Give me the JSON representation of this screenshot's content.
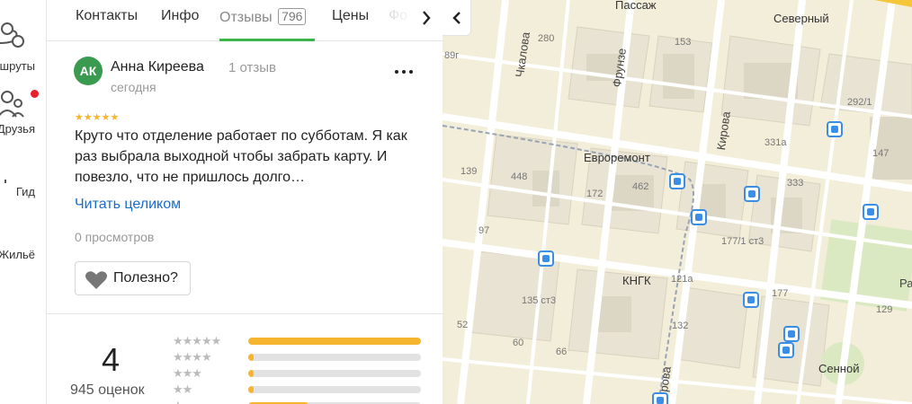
{
  "rail": {
    "items": [
      {
        "label": "Маршруты"
      },
      {
        "label": "Друзья"
      },
      {
        "label": "Гид"
      },
      {
        "label": "Жильё"
      }
    ]
  },
  "tabs": {
    "items": [
      {
        "label": "Контакты"
      },
      {
        "label": "Инфо"
      },
      {
        "label": "Отзывы",
        "count": "796"
      },
      {
        "label": "Цены"
      },
      {
        "label": "Фо"
      }
    ]
  },
  "review": {
    "avatar_initials": "АК",
    "author": "Анна Киреева",
    "review_count": "1 отзыв",
    "date": "сегодня",
    "stars": "★★★★★",
    "rating": 5,
    "text": "Круто что отделение работает по субботам. Я как раз выбрала выходной чтобы забрать карту. И повезло, что не пришлось долго…",
    "read_more": "Читать целиком",
    "views": "0 просмотров",
    "useful_label": "Полезно?"
  },
  "summary": {
    "rating": "4",
    "count": "945 оценок",
    "distribution": [
      {
        "stars": "★★★★★",
        "fraction": 1.0
      },
      {
        "stars": "★★★★",
        "fraction": 0.03
      },
      {
        "stars": "★★★",
        "fraction": 0.02
      },
      {
        "stars": "★★",
        "fraction": 0.03
      },
      {
        "stars": "★",
        "fraction": 0.35
      }
    ]
  },
  "map": {
    "labels": {
      "passage": "Пассаж",
      "severny": "Северный",
      "chkalova": "Чкалова",
      "frunze": "Фрунзе",
      "kirova_top": "Кирова",
      "kirova_bottom": "Кирова",
      "evroremont": "Евроремонт",
      "kngk": "КНГК",
      "sennoy": "Сенной",
      "rash": "Раше",
      "h280": "280",
      "h153": "153",
      "h2921": "292/1",
      "h331a": "331а",
      "h147": "147",
      "h139": "139",
      "h448": "448",
      "h172": "172",
      "h462": "462",
      "h333": "333",
      "h97": "97",
      "h1771": "177/1 ст3",
      "h121a": "121а",
      "h135": "135 ст3",
      "h177": "177",
      "h129": "129",
      "h52": "52",
      "h60": "60",
      "h66": "66",
      "h132": "132",
      "h89g": "89г"
    }
  },
  "colors": {
    "accent_green": "#3bb44a",
    "avatar_green": "#3a9a4f",
    "link_blue": "#1a6dca",
    "star_gold": "#f5b52e",
    "notification_red": "#e8202a",
    "transit_blue": "#3a8ee6"
  },
  "icons": {
    "rail": [
      "routes-icon",
      "friends-icon",
      "guide-flag-icon",
      "housing-icon"
    ],
    "tabs_next": "chevron-right-icon",
    "collapse": "chevron-left-icon",
    "more": "more-dots-icon",
    "useful": "heart-icon",
    "transit": "bus-stop-icon"
  }
}
